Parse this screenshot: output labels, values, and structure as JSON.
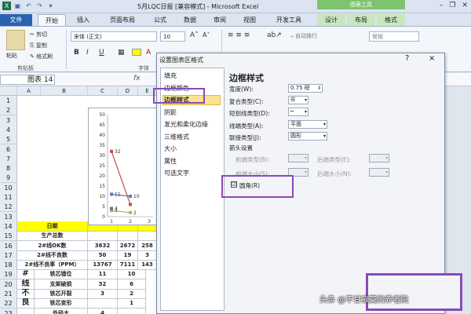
{
  "title_bar": {
    "window_title": "5月LQC日报 [兼容模式] - Microsoft Excel",
    "context_tools": "图表工具"
  },
  "tabs": {
    "file": "文件",
    "home": "开始",
    "insert": "插入",
    "page_layout": "页面布局",
    "formulas": "公式",
    "data": "数据",
    "review": "审阅",
    "view": "视图",
    "developer": "开发工具",
    "design": "设计",
    "layout": "布局",
    "format": "格式"
  },
  "ribbon": {
    "paste": "粘贴",
    "cut": "剪切",
    "copy": "复制",
    "format_painter": "格式刷",
    "clipboard_group": "剪贴板",
    "font_name": "宋体 (正文)",
    "font_size": "10",
    "bold": "B",
    "italic": "I",
    "underline": "U",
    "font_group": "字体",
    "wrap_text": "自动换行",
    "number_format": "常规"
  },
  "formula_bar": {
    "name_box": "图表 14",
    "fx": "fx"
  },
  "sheet": {
    "columns": [
      "A",
      "B",
      "C",
      "D",
      "E",
      "F"
    ],
    "rows": [
      "1",
      "2",
      "3",
      "4",
      "5",
      "6",
      "7",
      "8",
      "9",
      "10",
      "11",
      "12",
      "13",
      "14",
      "15",
      "16",
      "17",
      "18",
      "19",
      "20",
      "21",
      "22",
      "23"
    ],
    "table": [
      {
        "row": "14",
        "cells": [
          "日期",
          "",
          "",
          ""
        ]
      },
      {
        "row": "15",
        "cells": [
          "生产总数",
          "",
          "",
          ""
        ]
      },
      {
        "row": "16",
        "cells": [
          "2#线OK数",
          "3632",
          "2672",
          "258"
        ]
      },
      {
        "row": "17",
        "cells": [
          "2#线不良数",
          "50",
          "19",
          "3"
        ]
      },
      {
        "row": "18",
        "cells": [
          "2#线不良率（PPM）",
          "13767",
          "7111",
          "143"
        ]
      },
      {
        "row": "19",
        "cells": [
          "#",
          "铁芯错位",
          "11",
          "10"
        ]
      },
      {
        "row": "20",
        "cells": [
          "线",
          "支架破损",
          "32",
          "6"
        ]
      },
      {
        "row": "21",
        "cells": [
          "不",
          "铁芯开裂",
          "3",
          "2"
        ]
      },
      {
        "row": "22",
        "cells": [
          "良",
          "铁芯变形",
          "",
          "1"
        ]
      },
      {
        "row": "23",
        "cells": [
          "",
          "外径大",
          "4",
          ""
        ]
      }
    ]
  },
  "chart_data": {
    "type": "line",
    "categories": [
      "1",
      "2",
      "3"
    ],
    "ylim": [
      0,
      50
    ],
    "yticks": [
      "0",
      "5",
      "10",
      "15",
      "20",
      "25",
      "30",
      "35",
      "40",
      "45",
      "50"
    ],
    "series": [
      {
        "values": [
          11,
          10,
          null
        ],
        "color": "#4f81bd",
        "labels": [
          "11",
          "10",
          ""
        ]
      },
      {
        "values": [
          32,
          6,
          null
        ],
        "color": "#c0504d",
        "labels": [
          "32",
          "",
          ""
        ]
      },
      {
        "values": [
          3,
          2,
          null
        ],
        "color": "#9bbb59",
        "labels": [
          "3",
          "2",
          ""
        ]
      },
      {
        "values": [
          4,
          null,
          null
        ],
        "color": "#8064a2",
        "labels": [
          "4",
          "",
          ""
        ]
      }
    ]
  },
  "dialog": {
    "title": "设置图表区格式",
    "help": "?",
    "close": "×",
    "nav": [
      "填充",
      "边框颜色",
      "边框样式",
      "阴影",
      "发光和柔化边缘",
      "三维格式",
      "大小",
      "属性",
      "可选文字"
    ],
    "selected_nav": "边框样式",
    "heading": "边框样式",
    "width_label": "宽度(W):",
    "width_value": "0.75 磅",
    "compound_label": "复合类型(C):",
    "dash_label": "短划线类型(D):",
    "cap_label": "线端类型(A):",
    "cap_value": "平面",
    "join_label": "联接类型(J):",
    "join_value": "圆形",
    "arrow_section": "箭头设置",
    "begin_type": "前端类型(B):",
    "end_type": "后端类型(E):",
    "begin_size": "前端大小(S):",
    "end_size": "后端大小(N):",
    "rounded_label": "圆角(R)",
    "rounded_checked": "☑"
  },
  "watermark": "头条 @不甘寂寞的养老院"
}
